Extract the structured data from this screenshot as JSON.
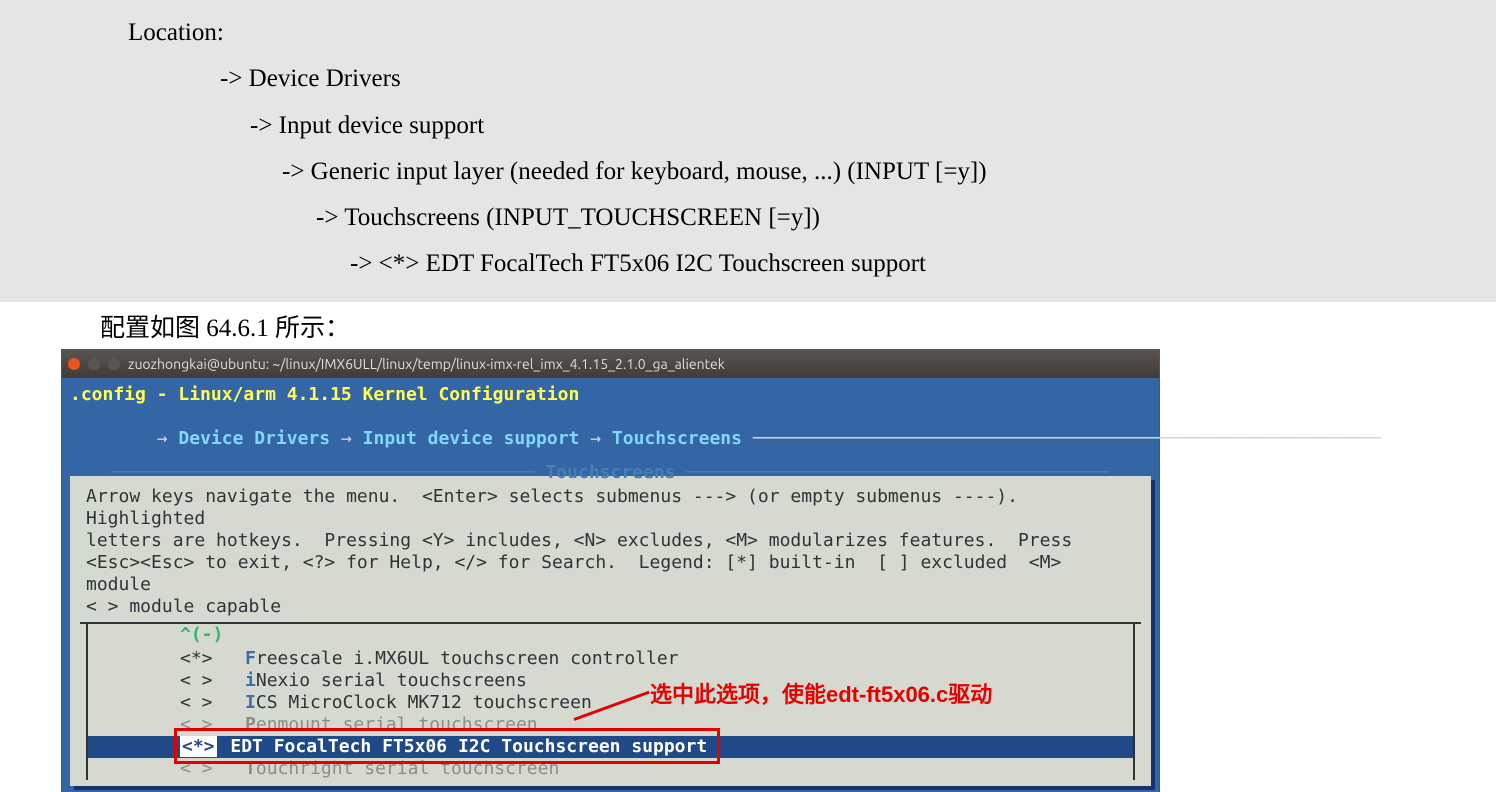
{
  "location": {
    "heading": "Location:",
    "l1": "-> Device Drivers",
    "l2": "-> Input device support",
    "l3": "-> Generic input layer (needed for keyboard, mouse, ...) (INPUT [=y])",
    "l4": "-> Touchscreens (INPUT_TOUCHSCREEN [=y])",
    "l5": "-> <*> EDT FocalTech FT5x06 I2C Touchscreen support"
  },
  "caption": "配置如图 64.6.1 所示：",
  "terminal": {
    "title": "zuozhongkai@ubuntu: ~/linux/IMX6ULL/linux/temp/linux-imx-rel_imx_4.1.15_2.1.0_ga_alientek",
    "config_title": ".config - Linux/arm 4.1.15 Kernel Configuration",
    "arrow": "→",
    "crumbs": [
      "Device Drivers",
      "Input device support",
      "Touchscreens"
    ],
    "menu_heading": "Touchscreens",
    "help1": "Arrow keys navigate the menu.  <Enter> selects submenus ---> (or empty submenus ----).  Highlighted",
    "help2": "letters are hotkeys.  Pressing <Y> includes, <N> excludes, <M> modularizes features.  Press",
    "help3": "<Esc><Esc> to exit, <?> for Help, </> for Search.  Legend: [*] built-in  [ ] excluded  <M> module ",
    "help4": "< > module capable",
    "scroll_up": "^(-)",
    "options": [
      {
        "mark": "<*>",
        "hot": "F",
        "rest": "reescale i.MX6UL touchscreen controller"
      },
      {
        "mark": "< >",
        "hot": "i",
        "rest": "Nexio serial touchscreens"
      },
      {
        "mark": "< >",
        "hot": "I",
        "rest": "CS MicroClock MK712 touchscreen"
      },
      {
        "mark": "< >",
        "hot": "P",
        "rest": "enmount serial touchscreen",
        "dim": true
      },
      {
        "mark": "<*>",
        "hot": "E",
        "rest": "DT FocalTech FT5x06 I2C Touchscreen support",
        "selected": true
      },
      {
        "mark": "< >",
        "hot": "T",
        "rest": "ouchright serial touchscreen",
        "dim": true
      }
    ]
  },
  "annotation": {
    "text": "选中此选项，使能edt-ft5x06.c驱动"
  }
}
